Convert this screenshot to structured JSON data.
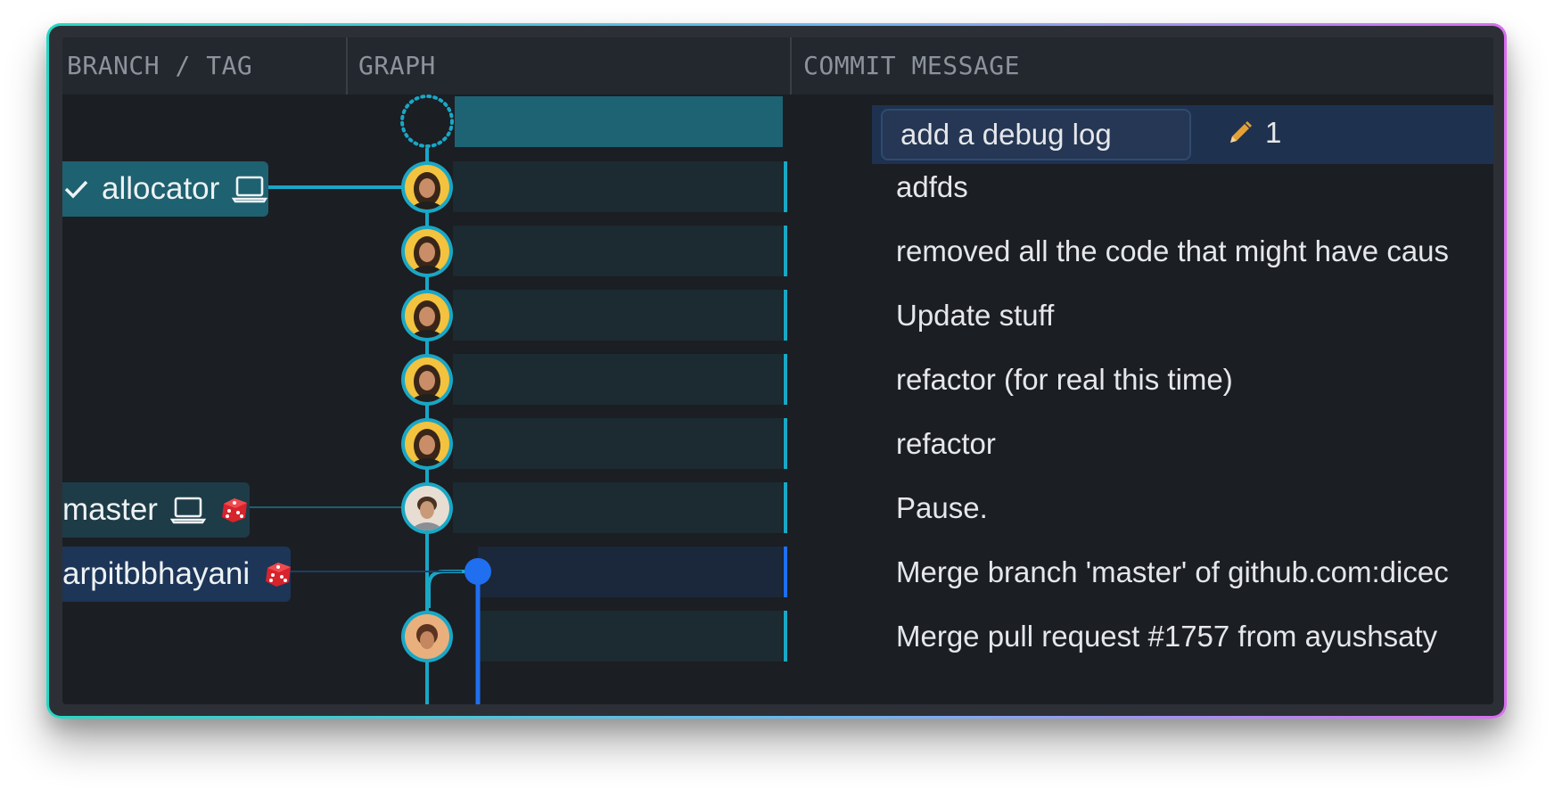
{
  "header": {
    "branch_col": "BRANCH / TAG",
    "graph_col": "GRAPH",
    "message_col": "COMMIT MESSAGE"
  },
  "wip": {
    "message": "add a debug log",
    "changed_count": "1",
    "icon": "pencil-icon"
  },
  "branches": [
    {
      "label": "allocator",
      "checked": true,
      "icons": [
        "check-icon",
        "laptop-icon"
      ]
    },
    {
      "label": "master",
      "icons": [
        "laptop-icon",
        "dice-icon"
      ]
    },
    {
      "label": "arpitbbhayani",
      "icons": [
        "dice-icon"
      ]
    }
  ],
  "commits": [
    {
      "message": "adfds"
    },
    {
      "message": "removed all the code that might have caus"
    },
    {
      "message": "Update stuff"
    },
    {
      "message": "refactor (for real this time)"
    },
    {
      "message": "refactor"
    },
    {
      "message": "Pause."
    },
    {
      "message": "Merge branch 'master' of github.com:dicec"
    },
    {
      "message": "Merge pull request #1757 from ayushsaty"
    }
  ],
  "colors": {
    "teal_lane": "#19a7c6",
    "blue_lane": "#1f6ff0",
    "teal_tag": "#1e6170",
    "blue_tag": "#1d3557",
    "row_bg": "#1c2a31"
  }
}
